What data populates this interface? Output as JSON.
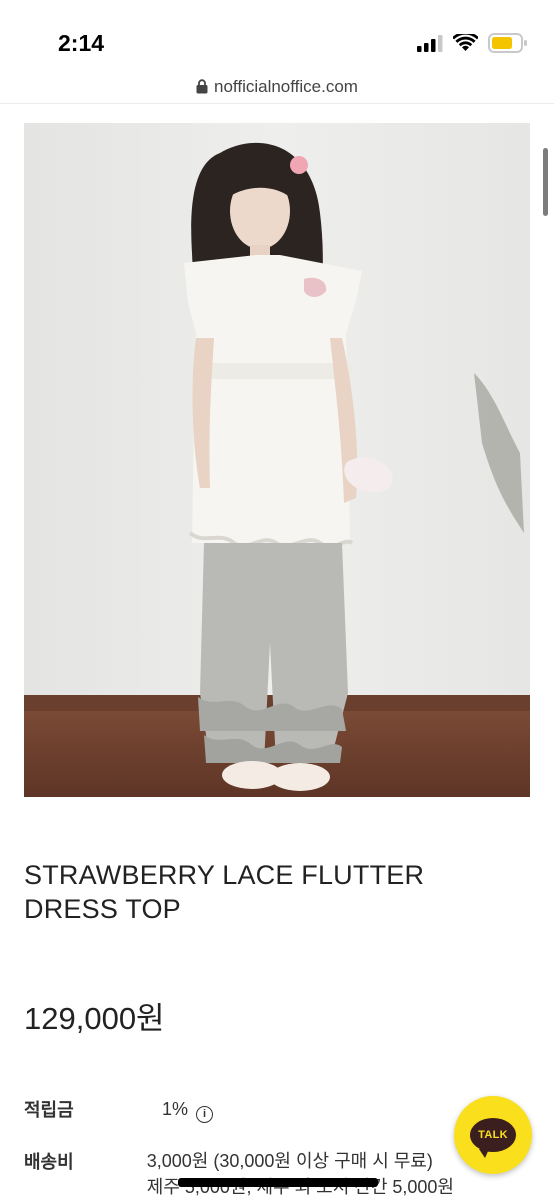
{
  "status_bar": {
    "time": "2:14",
    "icons": [
      "cellular-signal-icon",
      "wifi-icon",
      "battery-icon"
    ],
    "battery_color": "#f5c400"
  },
  "browser": {
    "url": "nofficialnoffice.com",
    "lock_icon": "lock-icon"
  },
  "product": {
    "image_icon": "product-photo",
    "title": "STRAWBERRY LACE FLUTTER DRESS TOP",
    "price": "129,000원"
  },
  "info": {
    "points_label": "적립금",
    "points_value": "1%",
    "points_info_icon": "info-icon",
    "shipping_label": "배송비",
    "shipping_line1": "3,000원 (30,000원 이상 구매 시 무료)",
    "shipping_line2": "제주 5,000원, 제주 외 도서 산간 5,000원"
  },
  "chat": {
    "label": "TALK",
    "color": "#f9df1c"
  }
}
